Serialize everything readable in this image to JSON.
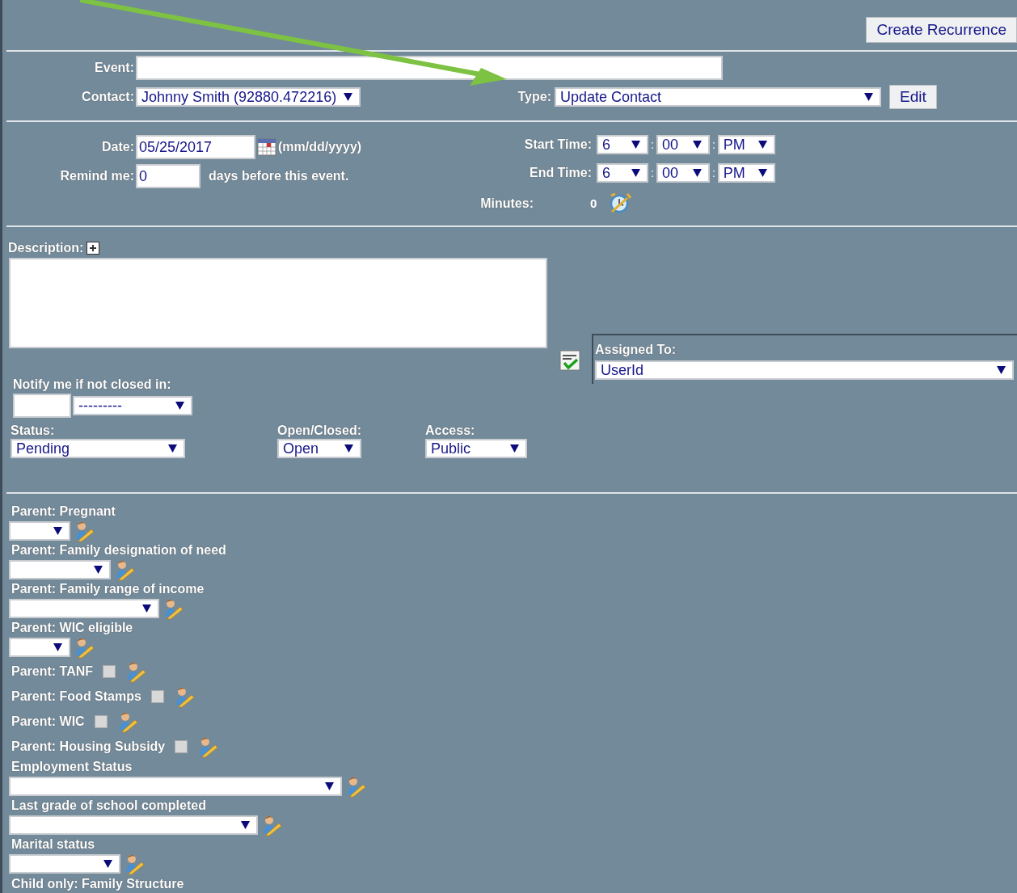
{
  "header": {
    "button": "Create Recurrence"
  },
  "event": {
    "label": "Event:"
  },
  "contact": {
    "label": "Contact:",
    "value": "Johnny Smith (92880.472216)"
  },
  "type": {
    "label": "Type:",
    "value": "Update Contact",
    "button": "Edit"
  },
  "date": {
    "label": "Date:",
    "value": "05/25/2017",
    "hint": "(mm/dd/yyyy)"
  },
  "remind": {
    "label": "Remind me:",
    "value": "0",
    "suffix": "days before this event."
  },
  "start_time": {
    "label": "Start Time:",
    "hour": "6",
    "separator_1": ":",
    "minute": "00",
    "separator_2": ":",
    "ampm": "PM"
  },
  "end_time": {
    "label": "End Time:",
    "hour": "6",
    "separator_1": ":",
    "minute": "00",
    "separator_2": ":",
    "ampm": "PM"
  },
  "minutes": {
    "label": "Minutes:",
    "value": "0"
  },
  "description": {
    "label": "Description:"
  },
  "assigned_to": {
    "label": "Assigned To:",
    "value": "UserId"
  },
  "notify": {
    "label": "Notify me if not closed in:",
    "unit": "---------"
  },
  "status": {
    "label": "Status:",
    "value": "Pending"
  },
  "open_closed": {
    "label": "Open/Closed:",
    "value": "Open"
  },
  "access": {
    "label": "Access:",
    "value": "Public"
  },
  "custom_fields": [
    {
      "kind": "select",
      "label": "Parent: Pregnant"
    },
    {
      "kind": "select",
      "label": "Parent: Family designation of need"
    },
    {
      "kind": "select",
      "label": "Parent: Family range of income"
    },
    {
      "kind": "select",
      "label": "Parent: WIC eligible"
    },
    {
      "kind": "checkbox",
      "label": "Parent: TANF",
      "checked": false
    },
    {
      "kind": "checkbox",
      "label": "Parent: Food Stamps",
      "checked": false
    },
    {
      "kind": "checkbox",
      "label": "Parent: WIC",
      "checked": false
    },
    {
      "kind": "checkbox",
      "label": "Parent: Housing Subsidy",
      "checked": false
    },
    {
      "kind": "select",
      "label": "Employment Status"
    },
    {
      "kind": "select",
      "label": "Last grade of school completed"
    },
    {
      "kind": "select",
      "label": "Marital status"
    },
    {
      "kind": "label",
      "label": "Child only: Family Structure"
    }
  ]
}
